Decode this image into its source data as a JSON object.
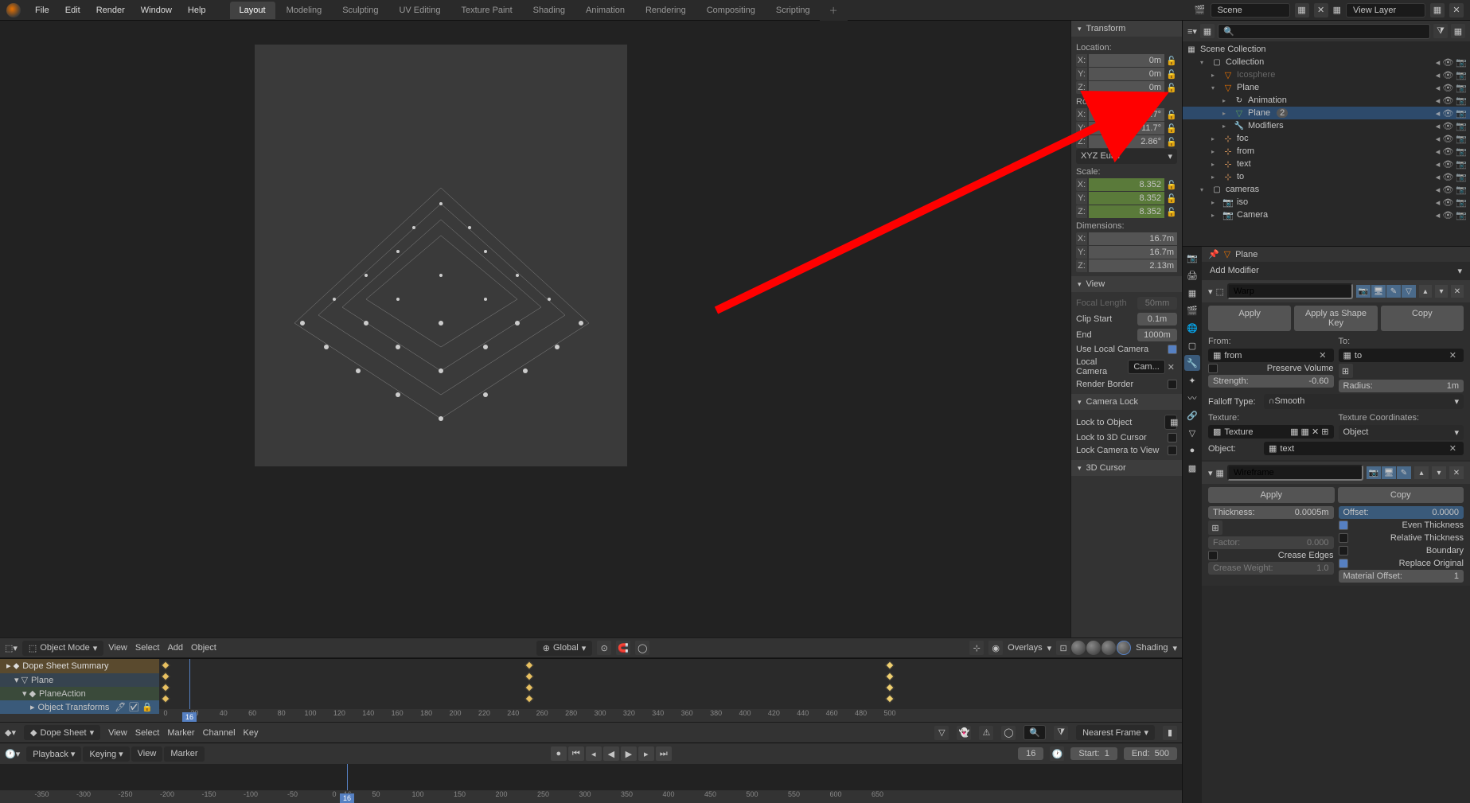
{
  "topbar": {
    "menus": [
      "File",
      "Edit",
      "Render",
      "Window",
      "Help"
    ],
    "tabs": [
      "Layout",
      "Modeling",
      "Sculpting",
      "UV Editing",
      "Texture Paint",
      "Shading",
      "Animation",
      "Rendering",
      "Compositing",
      "Scripting"
    ],
    "active_tab": 0,
    "scene_label": "Scene",
    "viewlayer_label": "View Layer"
  },
  "transform": {
    "title": "Transform",
    "location_label": "Location:",
    "location": {
      "x": "0m",
      "y": "0m",
      "z": "0m"
    },
    "rotation_label": "Rotation:",
    "rotation": {
      "x": "-12.7°",
      "y": "-11.7°",
      "z": "2.86°"
    },
    "rotation_mode": "XYZ Euler",
    "scale_label": "Scale:",
    "scale": {
      "x": "8.352",
      "y": "8.352",
      "z": "8.352"
    },
    "dimensions_label": "Dimensions:",
    "dimensions": {
      "x": "16.7m",
      "y": "16.7m",
      "z": "2.13m"
    }
  },
  "view": {
    "title": "View",
    "focal_label": "Focal Length",
    "focal_value": "50mm",
    "clipstart_label": "Clip Start",
    "clipstart_value": "0.1m",
    "end_label": "End",
    "end_value": "1000m",
    "local_cam_label": "Use Local Camera",
    "local_cam_field_label": "Local Camera",
    "local_cam_value": "Cam...",
    "render_border_label": "Render Border",
    "camera_lock_title": "Camera Lock",
    "lock_to_object_label": "Lock to Object",
    "lock_to_cursor_label": "Lock to 3D Cursor",
    "lock_cam_view_label": "Lock Camera to View",
    "cursor_title": "3D Cursor"
  },
  "vp_header": {
    "mode": "Object Mode",
    "menus": [
      "View",
      "Select",
      "Add",
      "Object"
    ],
    "orientation": "Global",
    "overlays_label": "Overlays",
    "shading_label": "Shading"
  },
  "dopesheet": {
    "rows": [
      "Dope Sheet Summary",
      "Plane",
      "PlaneAction",
      "Object Transforms"
    ],
    "frames": [
      0,
      20,
      40,
      60,
      80,
      100,
      120,
      140,
      160,
      180,
      200,
      220,
      240,
      260,
      280,
      300,
      320,
      340,
      360,
      380,
      400,
      420,
      440,
      460,
      480,
      500
    ],
    "current_frame": "16",
    "mode_label": "Dope Sheet",
    "menus": [
      "View",
      "Select",
      "Marker",
      "Channel",
      "Key"
    ],
    "sync_label": "Nearest Frame"
  },
  "timeline": {
    "menus": [
      "Playback",
      "Keying",
      "View",
      "Marker"
    ],
    "current": "16",
    "start_label": "Start:",
    "start": "1",
    "end_label": "End:",
    "end": "500",
    "ruler": [
      -350,
      -300,
      -250,
      -200,
      -150,
      -100,
      -50,
      0,
      16,
      50,
      100,
      150,
      200,
      250,
      300,
      350,
      400,
      450,
      500,
      550,
      600,
      650
    ]
  },
  "outliner": {
    "scene_collection": "Scene Collection",
    "items": [
      {
        "indent": 1,
        "icon": "collection",
        "label": "Collection",
        "expand": true
      },
      {
        "indent": 2,
        "icon": "mesh-tri",
        "label": "Icosphere",
        "disabled": true
      },
      {
        "indent": 2,
        "icon": "mesh-tri",
        "label": "Plane",
        "expand": true
      },
      {
        "indent": 3,
        "icon": "anim",
        "label": "Animation"
      },
      {
        "indent": 3,
        "icon": "mesh-tri-green",
        "label": "Plane",
        "selected": true,
        "badge": "2"
      },
      {
        "indent": 3,
        "icon": "wrench",
        "label": "Modifiers"
      },
      {
        "indent": 2,
        "icon": "empty",
        "label": "foc"
      },
      {
        "indent": 2,
        "icon": "empty",
        "label": "from"
      },
      {
        "indent": 2,
        "icon": "empty",
        "label": "text"
      },
      {
        "indent": 2,
        "icon": "empty",
        "label": "to"
      },
      {
        "indent": 1,
        "icon": "collection",
        "label": "cameras",
        "expand": true
      },
      {
        "indent": 2,
        "icon": "camera",
        "label": "iso"
      },
      {
        "indent": 2,
        "icon": "camera",
        "label": "Camera"
      }
    ]
  },
  "properties": {
    "context_label": "Plane",
    "add_modifier": "Add Modifier",
    "warp": {
      "name": "Warp",
      "apply": "Apply",
      "apply_shape": "Apply as Shape Key",
      "copy": "Copy",
      "from_label": "From:",
      "from_value": "from",
      "to_label": "To:",
      "to_value": "to",
      "preserve_label": "Preserve Volume",
      "strength_label": "Strength:",
      "strength_value": "-0.60",
      "radius_label": "Radius:",
      "radius_value": "1m",
      "falloff_label": "Falloff Type:",
      "falloff_value": "Smooth",
      "texture_label": "Texture:",
      "texture_value": "Texture",
      "texcoord_label": "Texture Coordinates:",
      "texcoord_value": "Object",
      "object_label": "Object:",
      "object_value": "text"
    },
    "wireframe": {
      "name": "Wireframe",
      "apply": "Apply",
      "copy": "Copy",
      "thickness_label": "Thickness:",
      "thickness_value": "0.0005m",
      "offset_label": "Offset:",
      "offset_value": "0.0000",
      "factor_label": "Factor:",
      "factor_value": "0.000",
      "even_label": "Even Thickness",
      "relative_label": "Relative Thickness",
      "crease_edges_label": "Crease Edges",
      "boundary_label": "Boundary",
      "crease_weight_label": "Crease Weight:",
      "crease_weight_value": "1.0",
      "replace_label": "Replace Original",
      "mat_offset_label": "Material Offset:",
      "mat_offset_value": "1"
    }
  }
}
